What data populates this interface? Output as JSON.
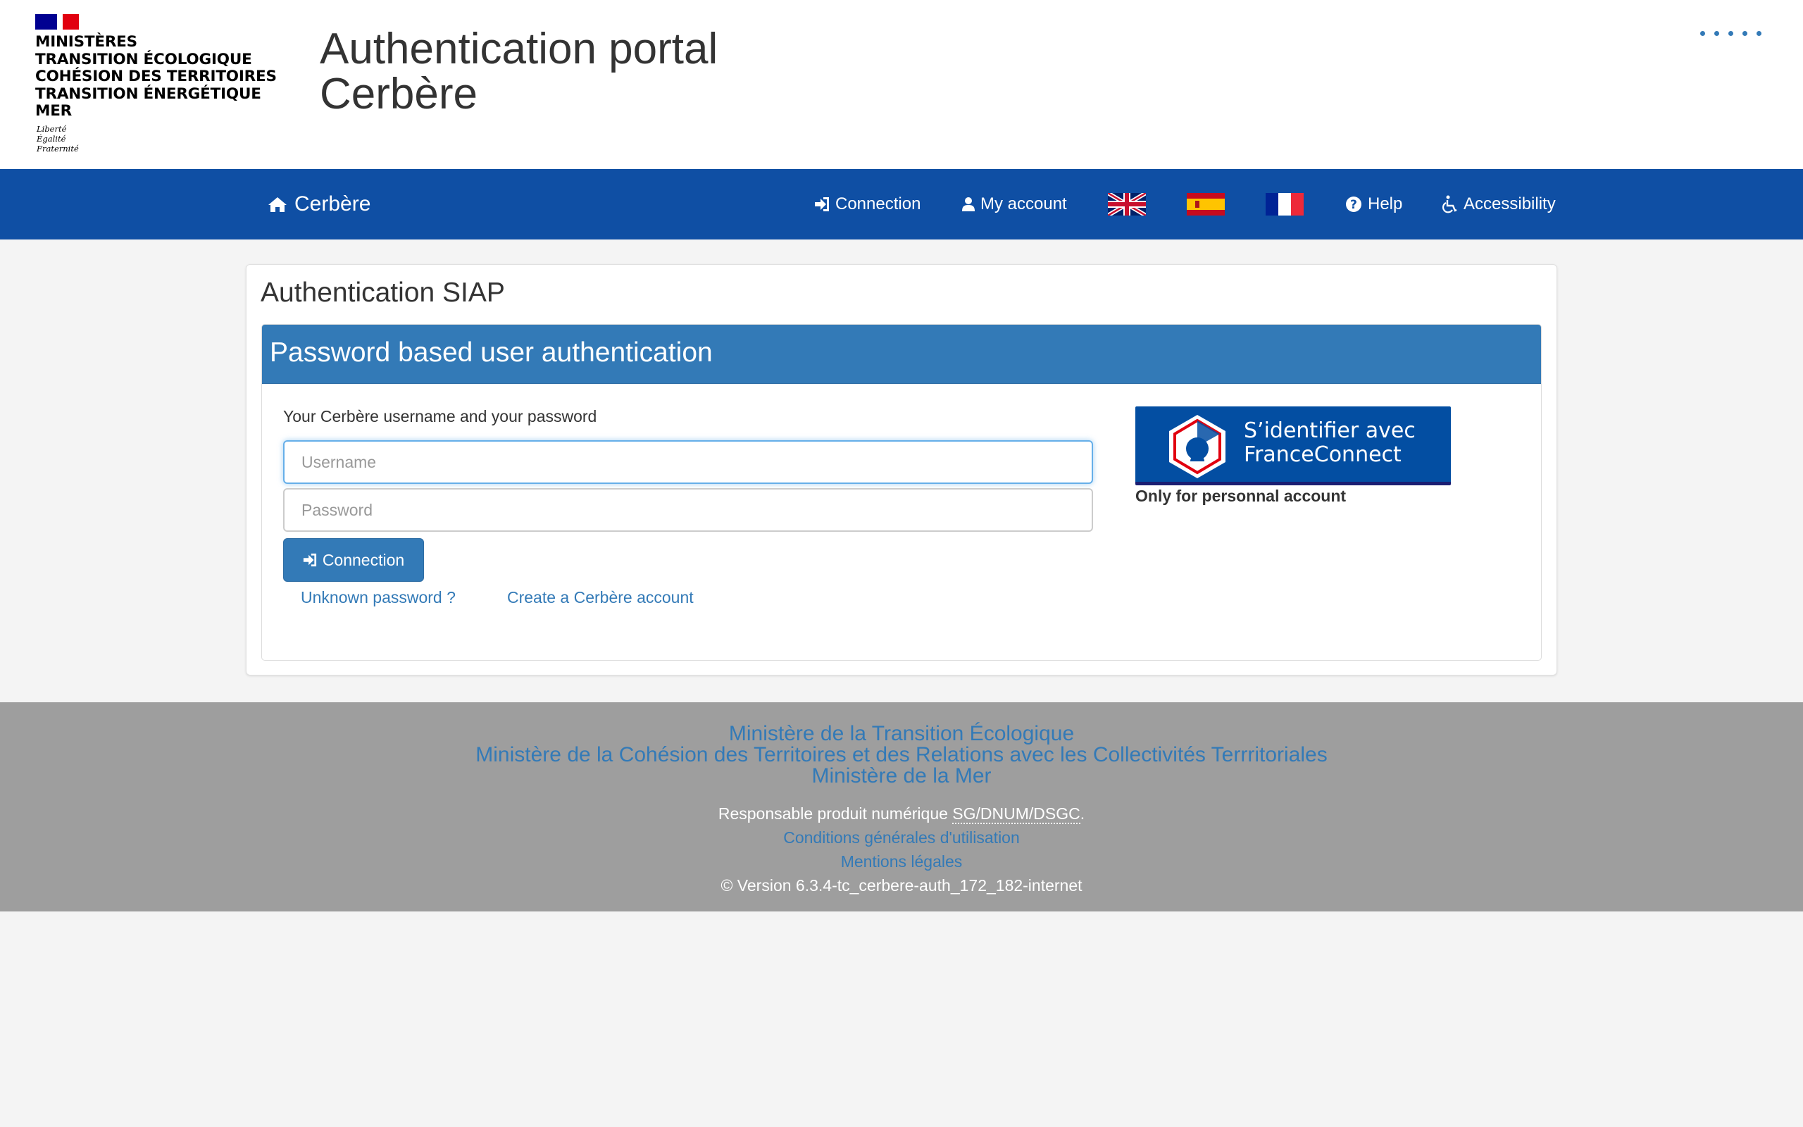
{
  "header": {
    "ministry_lines": [
      "MINISTÈRES",
      "TRANSITION ÉCOLOGIQUE",
      "COHÉSION DES TERRITOIRES",
      "TRANSITION ÉNERGÉTIQUE",
      "MER"
    ],
    "devise": [
      "Liberté",
      "Égalité",
      "Fraternité"
    ],
    "title_line1": "Authentication portal",
    "title_line2": "Cerbère"
  },
  "navbar": {
    "brand": "Cerbère",
    "connection": "Connection",
    "my_account": "My account",
    "help": "Help",
    "accessibility": "Accessibility",
    "languages": [
      "english-flag-icon",
      "spanish-flag-icon",
      "french-flag-icon"
    ]
  },
  "main": {
    "title": "Authentication SIAP",
    "panel_heading": "Password based user authentication",
    "form_label": "Your Cerbère username and your password",
    "username_placeholder": "Username",
    "password_placeholder": "Password",
    "connect_button": "Connection",
    "unknown_password": "Unknown password ?",
    "create_account": "Create a Cerbère account",
    "franceconnect_line1": "S’identifier avec",
    "franceconnect_line2": "FranceConnect",
    "franceconnect_note": "Only for personnal account"
  },
  "footer": {
    "ministry1": "Ministère de la Transition Écologique",
    "ministry2": "Ministère de la Cohésion des Territoires et des Relations avec les Collectivités Terrritoriales",
    "ministry3": "Ministère de la Mer",
    "responsable_prefix": "Responsable produit numérique ",
    "responsable_abbr": "SG/DNUM/DSGC",
    "responsable_suffix": ".",
    "cgu": "Conditions générales d'utilisation",
    "mentions": "Mentions légales",
    "version": "© Version 6.3.4-tc_cerbere-auth_172_182-internet"
  },
  "colors": {
    "navbar": "#0f4fa4",
    "primary": "#337ab7",
    "footer": "#9e9e9e",
    "franceconnect": "#034ea2"
  }
}
